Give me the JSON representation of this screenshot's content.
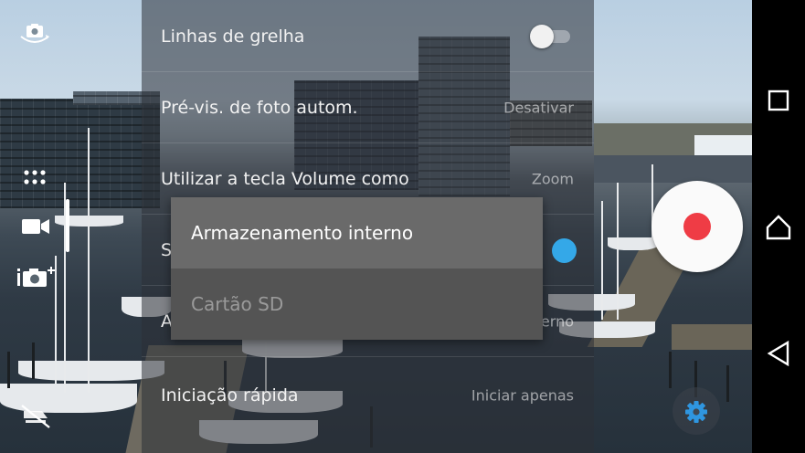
{
  "settings": {
    "grid_lines": {
      "label": "Linhas de grelha",
      "enabled": false
    },
    "auto_preview": {
      "label": "Pré-vis. de foto autom.",
      "value": "Desativar"
    },
    "volume_key": {
      "label": "Utilizar a tecla Volume como",
      "value": "Zoom"
    },
    "storage": {
      "label_fragment": "S",
      "value_fragment": "erno"
    },
    "partial_row": {
      "label_fragment": "A"
    },
    "quick_launch": {
      "label": "Iniciação rápida",
      "value": "Iniciar apenas"
    }
  },
  "storage_menu": {
    "options": [
      "Armazenamento interno",
      "Cartão SD"
    ],
    "selected": "Armazenamento interno"
  },
  "icons": {
    "top_left": "switch-camera-icon",
    "left_mid": "apps-grid-icon",
    "video": "video-camera-icon",
    "photo_plus": "camera-add-icon",
    "bottom_left": "flash-off-icon",
    "gear": "gear-icon",
    "nav": [
      "recents-icon",
      "home-icon",
      "back-icon"
    ]
  },
  "colors": {
    "record_red": "#ef3c45",
    "accent_blue": "#34a8e8",
    "gear_blue": "#2f96e0"
  }
}
